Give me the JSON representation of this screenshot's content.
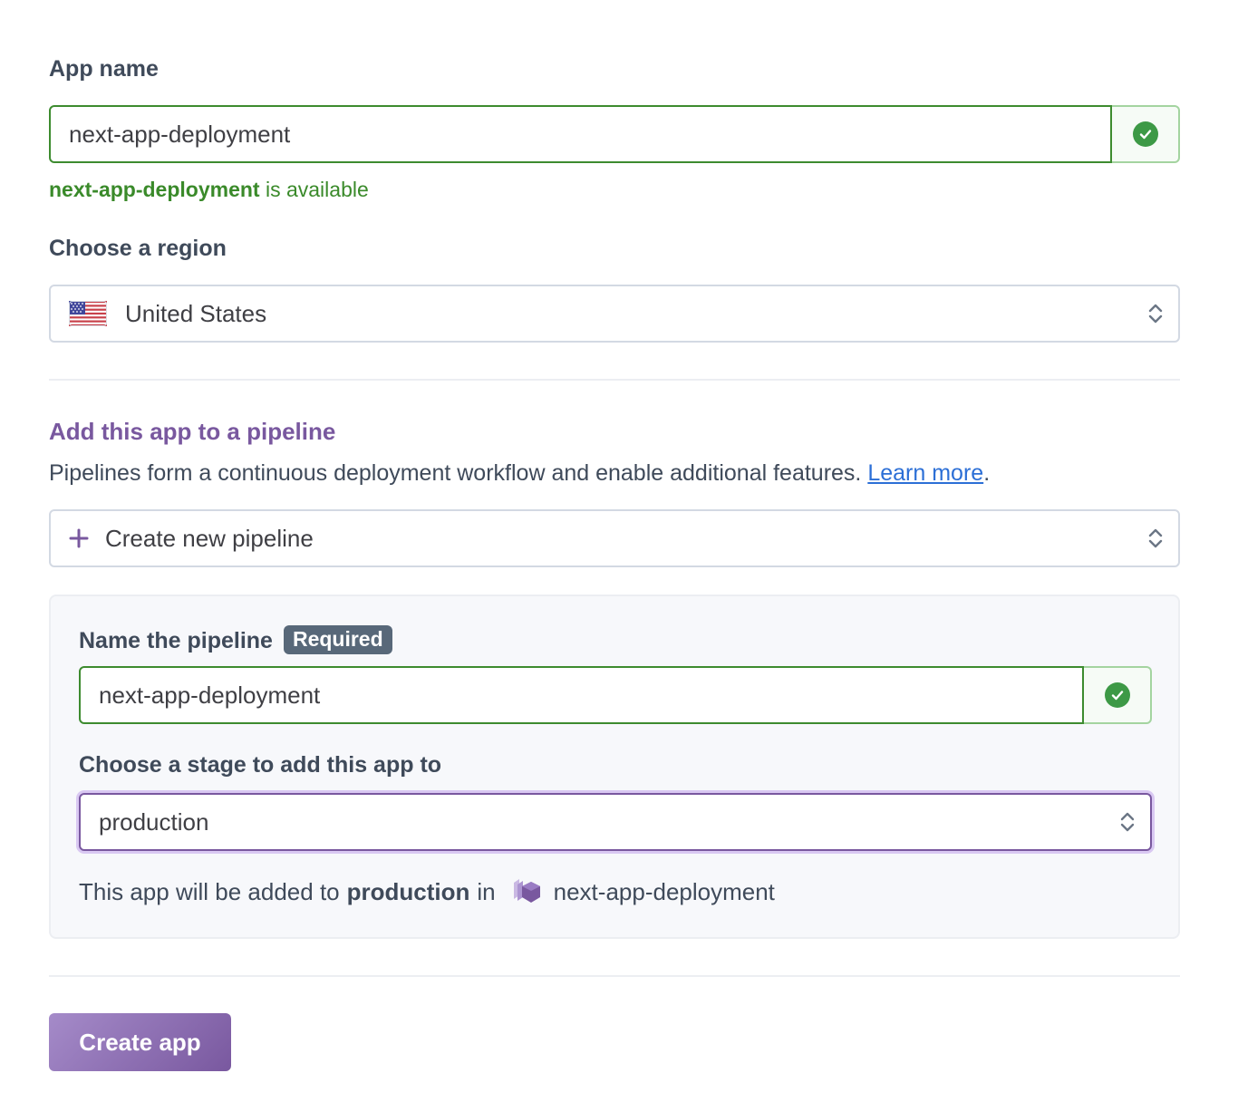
{
  "app_name": {
    "label": "App name",
    "value": "next-app-deployment",
    "availability_name": "next-app-deployment",
    "availability_suffix": " is available"
  },
  "region": {
    "label": "Choose a region",
    "selected": "United States",
    "flag_icon": "us-flag-icon"
  },
  "pipeline": {
    "title": "Add this app to a pipeline",
    "description": "Pipelines form a continuous deployment workflow and enable additional features. ",
    "learn_more": "Learn more",
    "description_end": ".",
    "selector": "Create new pipeline",
    "name_label": "Name the pipeline",
    "required_badge": "Required",
    "name_value": "next-app-deployment",
    "stage_label": "Choose a stage to add this app to",
    "stage_selected": "production",
    "info_prefix": "This app will be added to",
    "info_stage": "production",
    "info_in": "in",
    "info_pipeline": "next-app-deployment"
  },
  "actions": {
    "create_label": "Create app"
  },
  "colors": {
    "accent": "#79589f",
    "success": "#3d8b2f",
    "link": "#2c6fd6"
  }
}
